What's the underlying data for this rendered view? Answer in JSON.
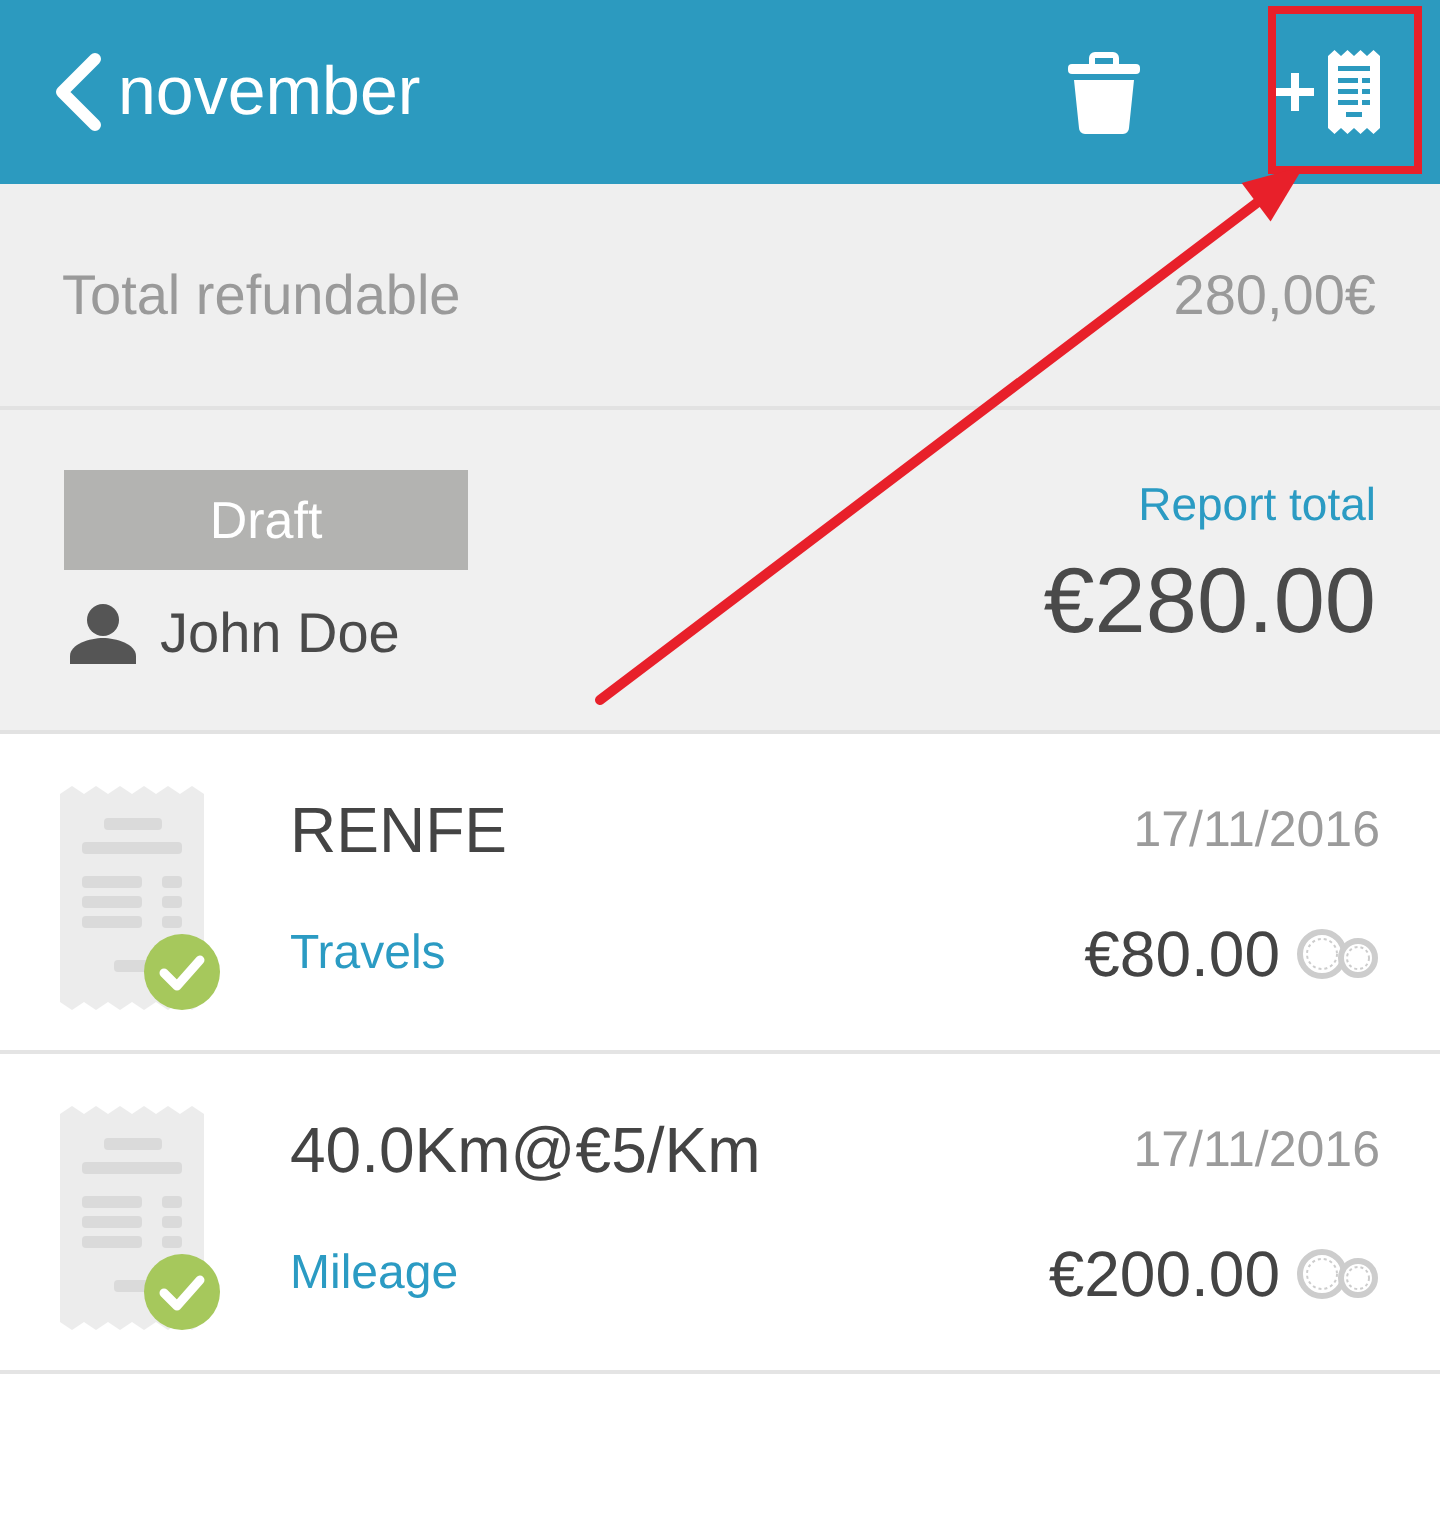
{
  "header": {
    "back_label": "november",
    "add_receipt_highlighted": true
  },
  "summary": {
    "label": "Total refundable",
    "value": "280,00€"
  },
  "report": {
    "status": "Draft",
    "owner": "John Doe",
    "total_label": "Report total",
    "total": "€280.00"
  },
  "expenses": [
    {
      "title": "RENFE",
      "category": "Travels",
      "date": "17/11/2016",
      "amount": "€80.00",
      "approved": true
    },
    {
      "title": "40.0Km@€5/Km",
      "category": "Mileage",
      "date": "17/11/2016",
      "amount": "€200.00",
      "approved": true
    }
  ]
}
